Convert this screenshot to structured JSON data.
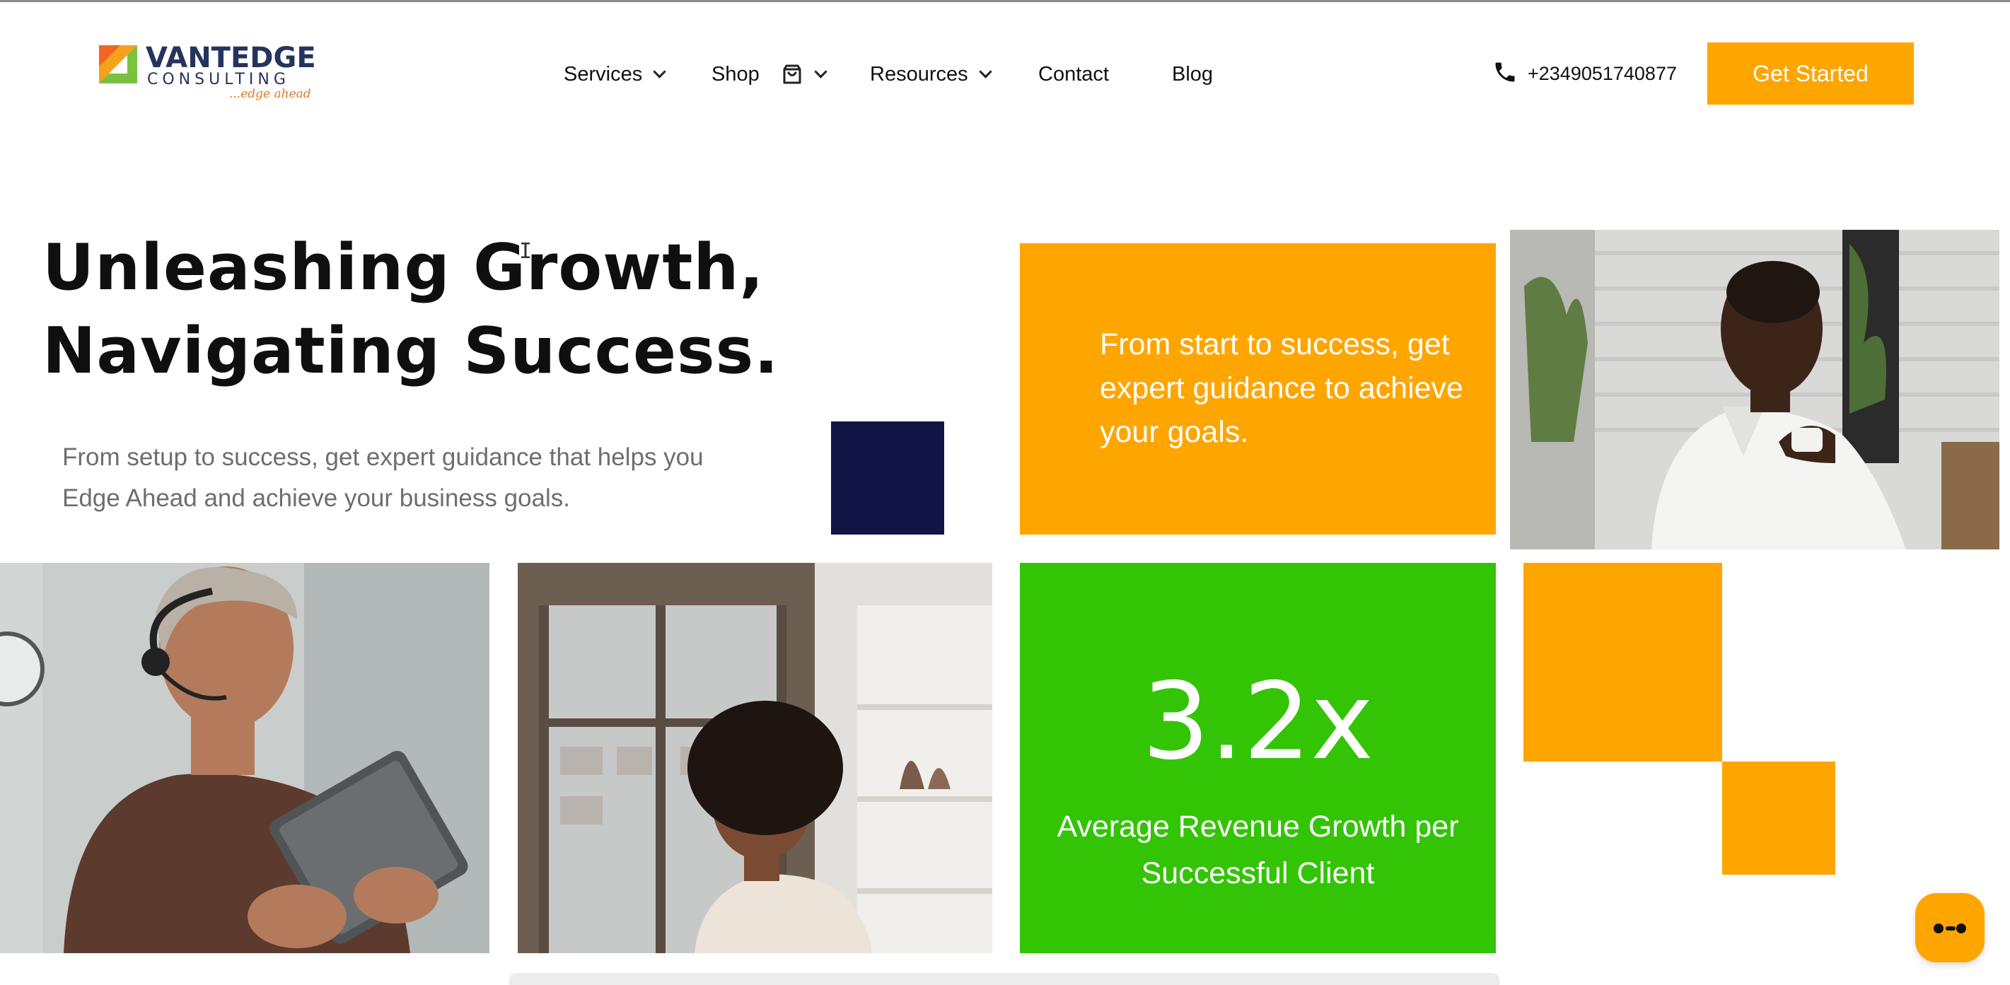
{
  "header": {
    "logo": {
      "name": "VANTEDGE",
      "subtitle": "CONSULTING",
      "tagline": "...edge ahead"
    },
    "nav": [
      {
        "label": "Services",
        "has_dropdown": true
      },
      {
        "label": "Shop",
        "has_dropdown": true,
        "icon": "shopping-bag-icon"
      },
      {
        "label": "Resources",
        "has_dropdown": true
      },
      {
        "label": "Contact",
        "has_dropdown": false
      },
      {
        "label": "Blog",
        "has_dropdown": false
      }
    ],
    "phone": "+2349051740877",
    "cta_label": "Get Started"
  },
  "hero": {
    "title_line1": "Unleashing Growth,",
    "title_line2": "Navigating Success.",
    "subtitle": "From setup to success, get expert guidance that helps you Edge Ahead and achieve your business goals."
  },
  "orange_card": {
    "text": "From start to success, get expert guidance to achieve your goals."
  },
  "stat_card": {
    "value": "3.2x",
    "label": "Average Revenue Growth per Successful Client"
  },
  "colors": {
    "accent_orange": "#ffa500",
    "accent_green": "#33c406",
    "navy": "#111546",
    "brand_text": "#26335e"
  },
  "chat_widget": {
    "icon": "chat-bubble-icon"
  }
}
